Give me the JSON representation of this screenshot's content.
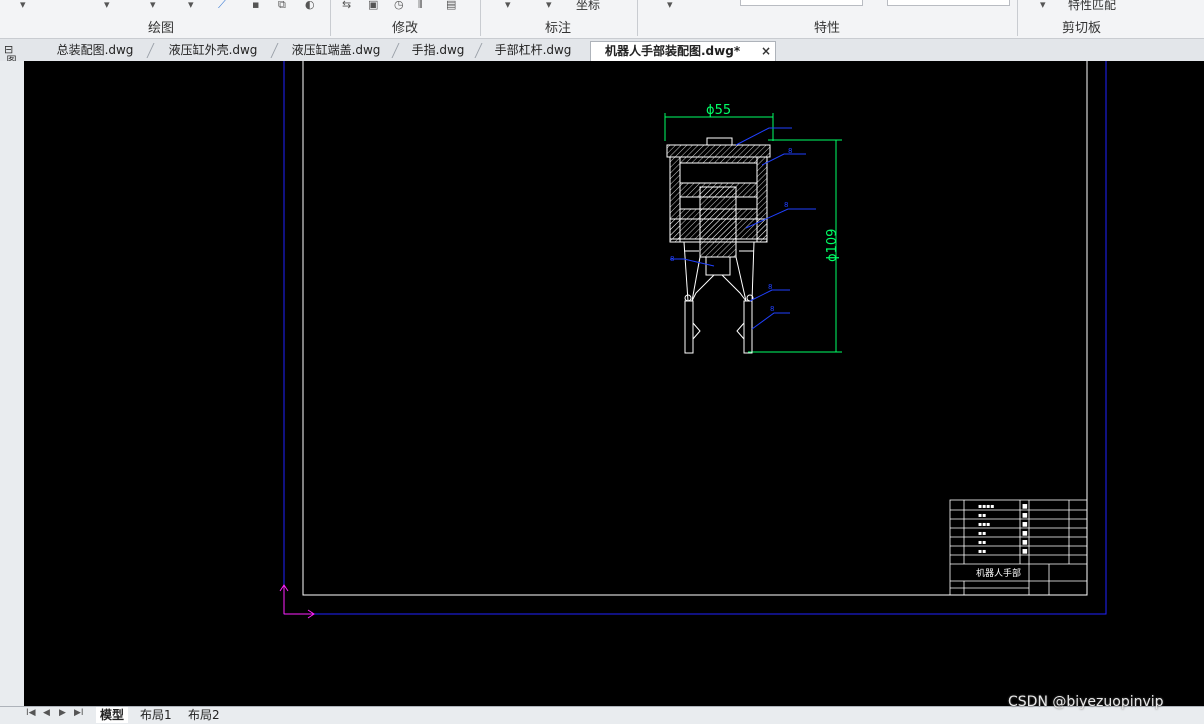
{
  "ribbon": {
    "groups": [
      "绘图",
      "修改",
      "标注",
      "特性",
      "剪切板"
    ],
    "layer_button": "坐标",
    "match_prop": "特性匹配"
  },
  "tabs": [
    {
      "label": "总装配图.dwg",
      "active": false
    },
    {
      "label": "液压缸外壳.dwg",
      "active": false
    },
    {
      "label": "液压缸端盖.dwg",
      "active": false
    },
    {
      "label": "手指.dwg",
      "active": false
    },
    {
      "label": "手部杠杆.dwg",
      "active": false
    },
    {
      "label": "机器人手部装配图.dwg*",
      "active": true
    }
  ],
  "tab_close": "×",
  "sidebar_label": "图形",
  "drawing": {
    "dim_width": "ϕ55",
    "dim_height": "ϕ109",
    "title_block_title": "机器人手部",
    "colors": {
      "frame": "#ffffff",
      "outer_frame": "#0000ff",
      "dim": "#00ff00",
      "leader": "#1f3cff",
      "ucs": "#ff00ff"
    }
  },
  "layout_tabs": [
    "模型",
    "布局1",
    "布局2"
  ],
  "nav_buttons": [
    "I◀",
    "◀",
    "▶",
    "▶I"
  ],
  "watermark": "CSDN @biyezuopinvip"
}
